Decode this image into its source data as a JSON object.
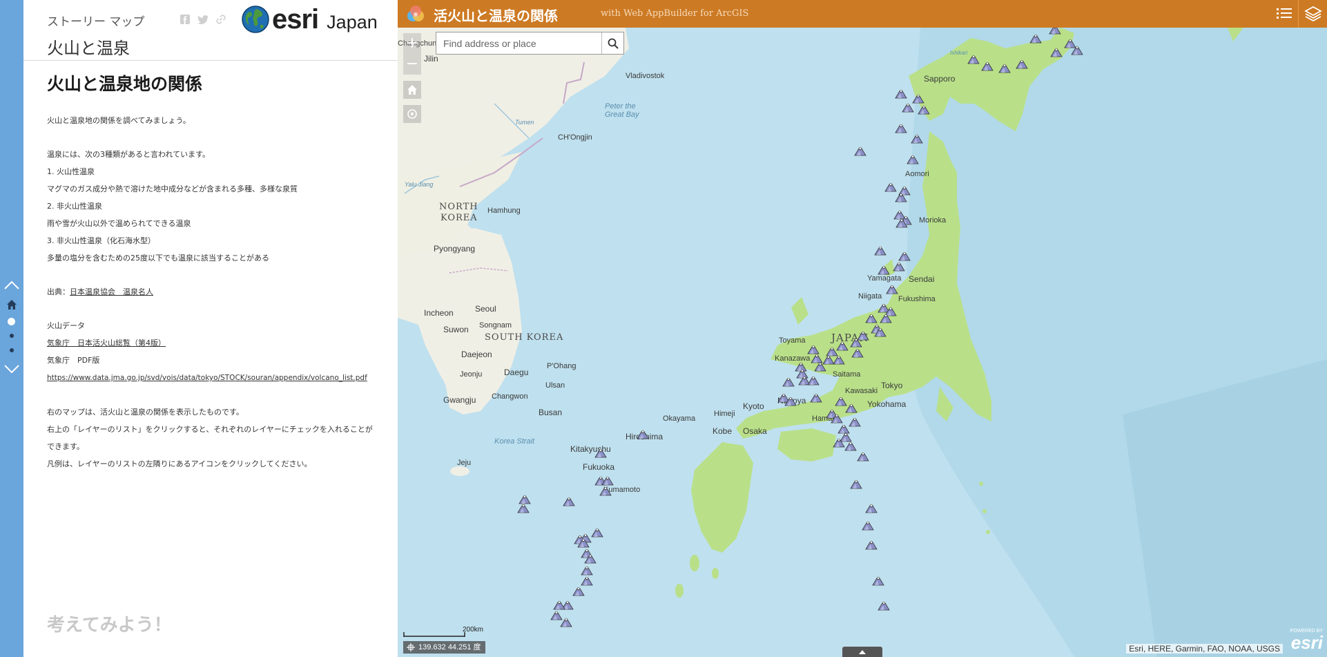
{
  "nav": {
    "up_label": "previous section",
    "down_label": "next section"
  },
  "story": {
    "kicker": "ストーリー マップ",
    "title": "火山と温泉",
    "logo_word": "esri",
    "logo_region": "Japan",
    "heading": "火山と温泉地の関係",
    "paragraphs": {
      "p1": "火山と温泉地の関係を調べてみましょう。",
      "p2": "温泉には、次の3種類があると言われています。",
      "p3": "1.  火山性温泉",
      "p4": "マグマのガス成分や熱で溶けた地中成分などが含まれる多種、多様な泉質",
      "p5": "2.  非火山性温泉",
      "p6": "雨や雪が火山以外で温められてできる温泉",
      "p7": "3.  非火山性温泉（化石海水型）",
      "p8": "多量の塩分を含むための25度以下でも温泉に該当することがある",
      "p9_prefix": "出典：",
      "p9_link": "日本温泉協会　温泉名人",
      "p10": "火山データ",
      "p11_link": "気象庁　日本活火山総覧（第4版）",
      "p12": "気象庁　PDF版",
      "p13_link": "https://www.data.jma.go.jp/svd/vois/data/tokyo/STOCK/souran/appendix/volcano_list.pdf",
      "p14": "右のマップは、活火山と温泉の関係を表示したものです。",
      "p15": "右上の「レイヤーのリスト」をクリックすると、それぞれのレイヤーにチェックを入れることができます。",
      "p16": "凡例は、レイヤーのリストの左隣りにあるアイコンをクリックしてください。"
    },
    "next_section": "考えてみよう！"
  },
  "app": {
    "title": "活火山と温泉の関係",
    "subtitle": "with Web AppBuilder for ArcGIS"
  },
  "search": {
    "placeholder": "Find address or place"
  },
  "map": {
    "zoom_in": "+",
    "zoom_out": "−",
    "scale_label": "200km",
    "coords": "139.632 44.251 度",
    "attribution": "Esri, HERE, Garmin, FAO, NOAA, USGS",
    "powered_by": "POWERED BY",
    "powered_esri": "esri",
    "colors": {
      "land": "#b9e089",
      "land_other": "#f0efe6",
      "sea": "#bfe0ee",
      "topbar": "#cd7a24",
      "nav": "#6aa5dc"
    },
    "places": {
      "jilin": "Jilin",
      "changchun": "Changchun",
      "vladivostok": "Vladivostok",
      "peter": "Peter the",
      "great_bay": "Great Bay",
      "chongjin": "CH'Ongjin",
      "tumen": "Tumen",
      "yalu": "Yalu Jiang",
      "north_korea_1": "NORTH",
      "north_korea_2": "KOREA",
      "hamhung": "Hamhung",
      "pyongyang": "Pyongyang",
      "seoul": "Seoul",
      "incheon": "Incheon",
      "suwon": "Suwon",
      "songnam": "Songnam",
      "south_korea": "SOUTH KOREA",
      "daejeon": "Daejeon",
      "jeonju": "Jeonju",
      "daegu": "Daegu",
      "pohang": "P'Ohang",
      "ulsan": "Ulsan",
      "gwangju": "Gwangju",
      "changwon": "Changwon",
      "busan": "Busan",
      "korea_strait": "Korea Strait",
      "jeju": "Jeju",
      "sapporo": "Sapporo",
      "aomori": "Aomori",
      "morioka": "Morioka",
      "yamagata": "Yamagata",
      "sendai": "Sendai",
      "niigata": "Niigata",
      "fukushima": "Fukushima",
      "toyama": "Toyama",
      "kanazawa": "Kanazawa",
      "japan": "JAPAN",
      "saitama": "Saitama",
      "tokyo": "Tokyo",
      "kawasaki": "Kawasaki",
      "yokohama": "Yokohama",
      "hamam": "Hamam",
      "nagoya": "Nagoya",
      "kyoto": "Kyoto",
      "himeji": "Himeji",
      "okayama": "Okayama",
      "kobe": "Kobe",
      "osaka": "Osaka",
      "hiroshima": "Hiroshima",
      "kitakyushu": "Kitakyushu",
      "fukuoka": "Fukuoka",
      "kumamoto": "Kumamoto",
      "ishikari": "Ishikari"
    }
  }
}
